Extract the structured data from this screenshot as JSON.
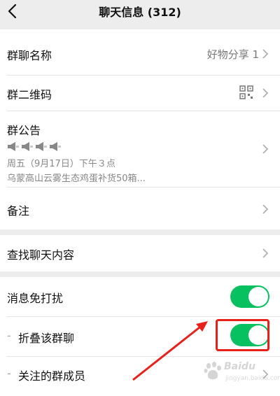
{
  "navbar": {
    "title": "聊天信息 (312)",
    "back_icon": "chevron-left-icon"
  },
  "group_name": {
    "label": "群聊名称",
    "value": "好物分享 1"
  },
  "qr_code": {
    "label": "群二维码",
    "icon": "qr-code-icon"
  },
  "notice": {
    "label": "群公告",
    "icons": [
      "megaphone-icon",
      "megaphone-icon",
      "megaphone-icon",
      "megaphone-icon"
    ],
    "line1": "周五（9月17日）下午３点",
    "line2": "乌蒙高山云雾生态鸡蛋补货50箱..."
  },
  "remark": {
    "label": "备注"
  },
  "search_history": {
    "label": "查找聊天内容"
  },
  "mute": {
    "label": "消息免打扰",
    "enabled": true
  },
  "fold": {
    "label": "折叠该群聊",
    "enabled": true
  },
  "followed": {
    "label": "关注的群成员"
  },
  "sub_dash": "-",
  "colors": {
    "toggle_on": "#07c160",
    "highlight": "#e8201a"
  },
  "watermark": {
    "text": "Baidu",
    "sub": "jingyan.baidu.com"
  }
}
